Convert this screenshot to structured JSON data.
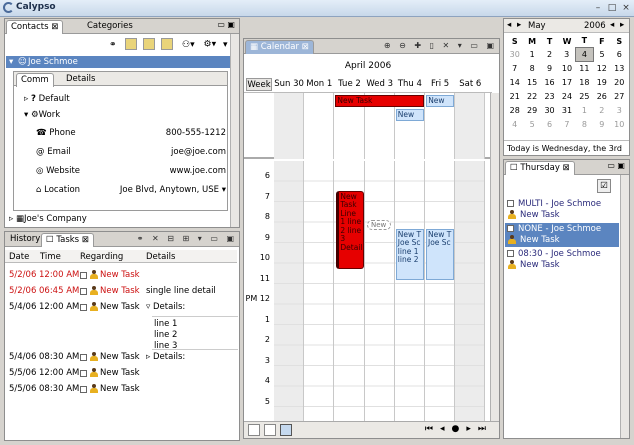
{
  "window": {
    "title": "Calypso"
  },
  "contacts": {
    "tabs": [
      "Contacts",
      "Categories"
    ],
    "selected_contact": "Joe Schmoe",
    "subtabs": [
      "Comm",
      "Details"
    ],
    "groups": [
      "Default",
      "Work"
    ],
    "fields": [
      {
        "label": "Phone",
        "value": "800-555-1212"
      },
      {
        "label": "Email",
        "value": "joe@joe.com"
      },
      {
        "label": "Website",
        "value": "www.joe.com"
      },
      {
        "label": "Location",
        "value": "Joe Blvd, Anytown, USE"
      }
    ],
    "company": "Joe's Company"
  },
  "tasks": {
    "tabs": [
      "History",
      "Tasks"
    ],
    "columns": [
      "Date",
      "Time",
      "Regarding",
      "Details"
    ],
    "rows": [
      {
        "date": "5/2/06",
        "time": "12:00 AM",
        "regarding": "New Task",
        "details": "",
        "red": true
      },
      {
        "date": "5/2/06",
        "time": "06:45 AM",
        "regarding": "New Task",
        "details": "single line detail",
        "red": true
      },
      {
        "date": "5/4/06",
        "time": "12:00 AM",
        "regarding": "New Task",
        "details": "Details:",
        "red": false
      },
      {
        "date": "5/4/06",
        "time": "08:30 AM",
        "regarding": "New Task",
        "details": "Details:",
        "red": false
      },
      {
        "date": "5/5/06",
        "time": "12:00 AM",
        "regarding": "New Task",
        "details": "",
        "red": false
      },
      {
        "date": "5/5/06",
        "time": "08:30 AM",
        "regarding": "New Task",
        "details": "",
        "red": false
      }
    ],
    "detail_lines": [
      "line 1",
      "line 2",
      "line 3"
    ]
  },
  "calendar": {
    "tab": "Calendar",
    "month_label": "April 2006",
    "week_label": "Week",
    "days": [
      "Sun 30",
      "Mon 1",
      "Tue 2",
      "Wed 3",
      "Thu 4",
      "Fri 5",
      "Sat 6"
    ],
    "allday_events": {
      "red": "New Task",
      "blue_fri": "New Ta",
      "blue_wed": "New Ta"
    },
    "hours": [
      "6",
      "7",
      "8",
      "9",
      "10",
      "11",
      "PM 12",
      "1",
      "2",
      "3",
      "4",
      "5"
    ],
    "timed_events": {
      "red_tue": "New Task Line 1 line 2 line 3 Detail",
      "new_label": "New",
      "thu": "New T Joe Sc line 1 line 2",
      "fri": "New T Joe Sc"
    }
  },
  "minical": {
    "month": "May",
    "year": "2006",
    "weekdays": [
      "S",
      "M",
      "T",
      "W",
      "T",
      "F",
      "S"
    ],
    "weeks": [
      [
        "30",
        "1",
        "2",
        "3",
        "4",
        "5",
        "6"
      ],
      [
        "7",
        "8",
        "9",
        "10",
        "11",
        "12",
        "13"
      ],
      [
        "14",
        "15",
        "16",
        "17",
        "18",
        "19",
        "20"
      ],
      [
        "21",
        "22",
        "23",
        "24",
        "25",
        "26",
        "27"
      ],
      [
        "28",
        "29",
        "30",
        "31",
        "1",
        "2",
        "3"
      ],
      [
        "4",
        "5",
        "6",
        "7",
        "8",
        "9",
        "10"
      ]
    ],
    "today_text": "Today is Wednesday, the 3rd"
  },
  "thursday": {
    "tab": "Thursday",
    "items": [
      {
        "title": "MULTI - Joe Schmoe",
        "task": "New Task"
      },
      {
        "title": "NONE - Joe Schmoe",
        "task": "New Task"
      },
      {
        "title": "08:30 - Joe Schmoe",
        "task": "New Task"
      }
    ]
  }
}
